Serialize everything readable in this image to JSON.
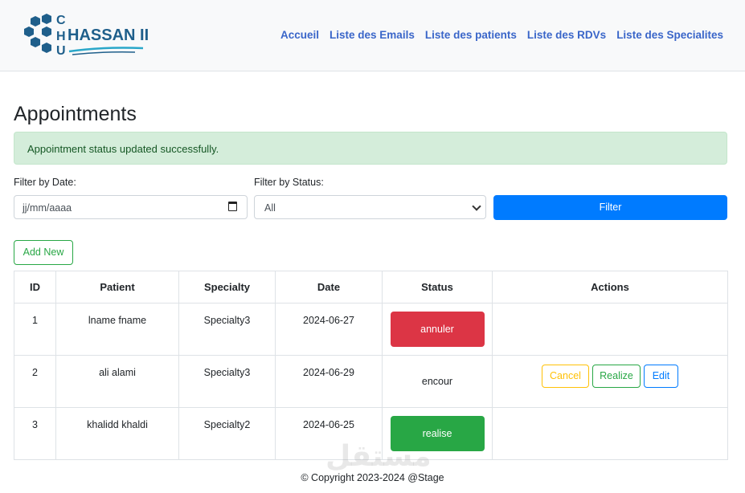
{
  "logo": {
    "text": "HASSAN II",
    "letters": [
      "C",
      "H",
      "U"
    ],
    "brand_color": "#1f5f8b"
  },
  "nav": {
    "links": [
      "Accueil",
      "Liste des Emails",
      "Liste des patients",
      "Liste des RDVs",
      "Liste des Specialites"
    ]
  },
  "page": {
    "title": "Appointments"
  },
  "alert": {
    "message": "Appointment status updated successfully."
  },
  "filters": {
    "date_label": "Filter by Date:",
    "date_placeholder": "jj/mm/aaaa",
    "status_label": "Filter by Status:",
    "status_selected": "All",
    "filter_button": "Filter"
  },
  "add_button": "Add New",
  "table": {
    "headers": [
      "ID",
      "Patient",
      "Specialty",
      "Date",
      "Status",
      "Actions"
    ],
    "rows": [
      {
        "id": "1",
        "patient": "lname fname",
        "specialty": "Specialty3",
        "date": "2024-06-27",
        "status": "annuler"
      },
      {
        "id": "2",
        "patient": "ali alami",
        "specialty": "Specialty3",
        "date": "2024-06-29",
        "status": "encour",
        "actions": [
          "Cancel",
          "Realize",
          "Edit"
        ]
      },
      {
        "id": "3",
        "patient": "khalidd khaldi",
        "specialty": "Specialty2",
        "date": "2024-06-25",
        "status": "realise"
      }
    ]
  },
  "footer": "© Copyright 2023-2024 @Stage",
  "colors": {
    "primary": "#007bff",
    "success": "#28a745",
    "danger": "#dc3545",
    "warning": "#ffc107",
    "nav_link": "#3a66c9"
  }
}
